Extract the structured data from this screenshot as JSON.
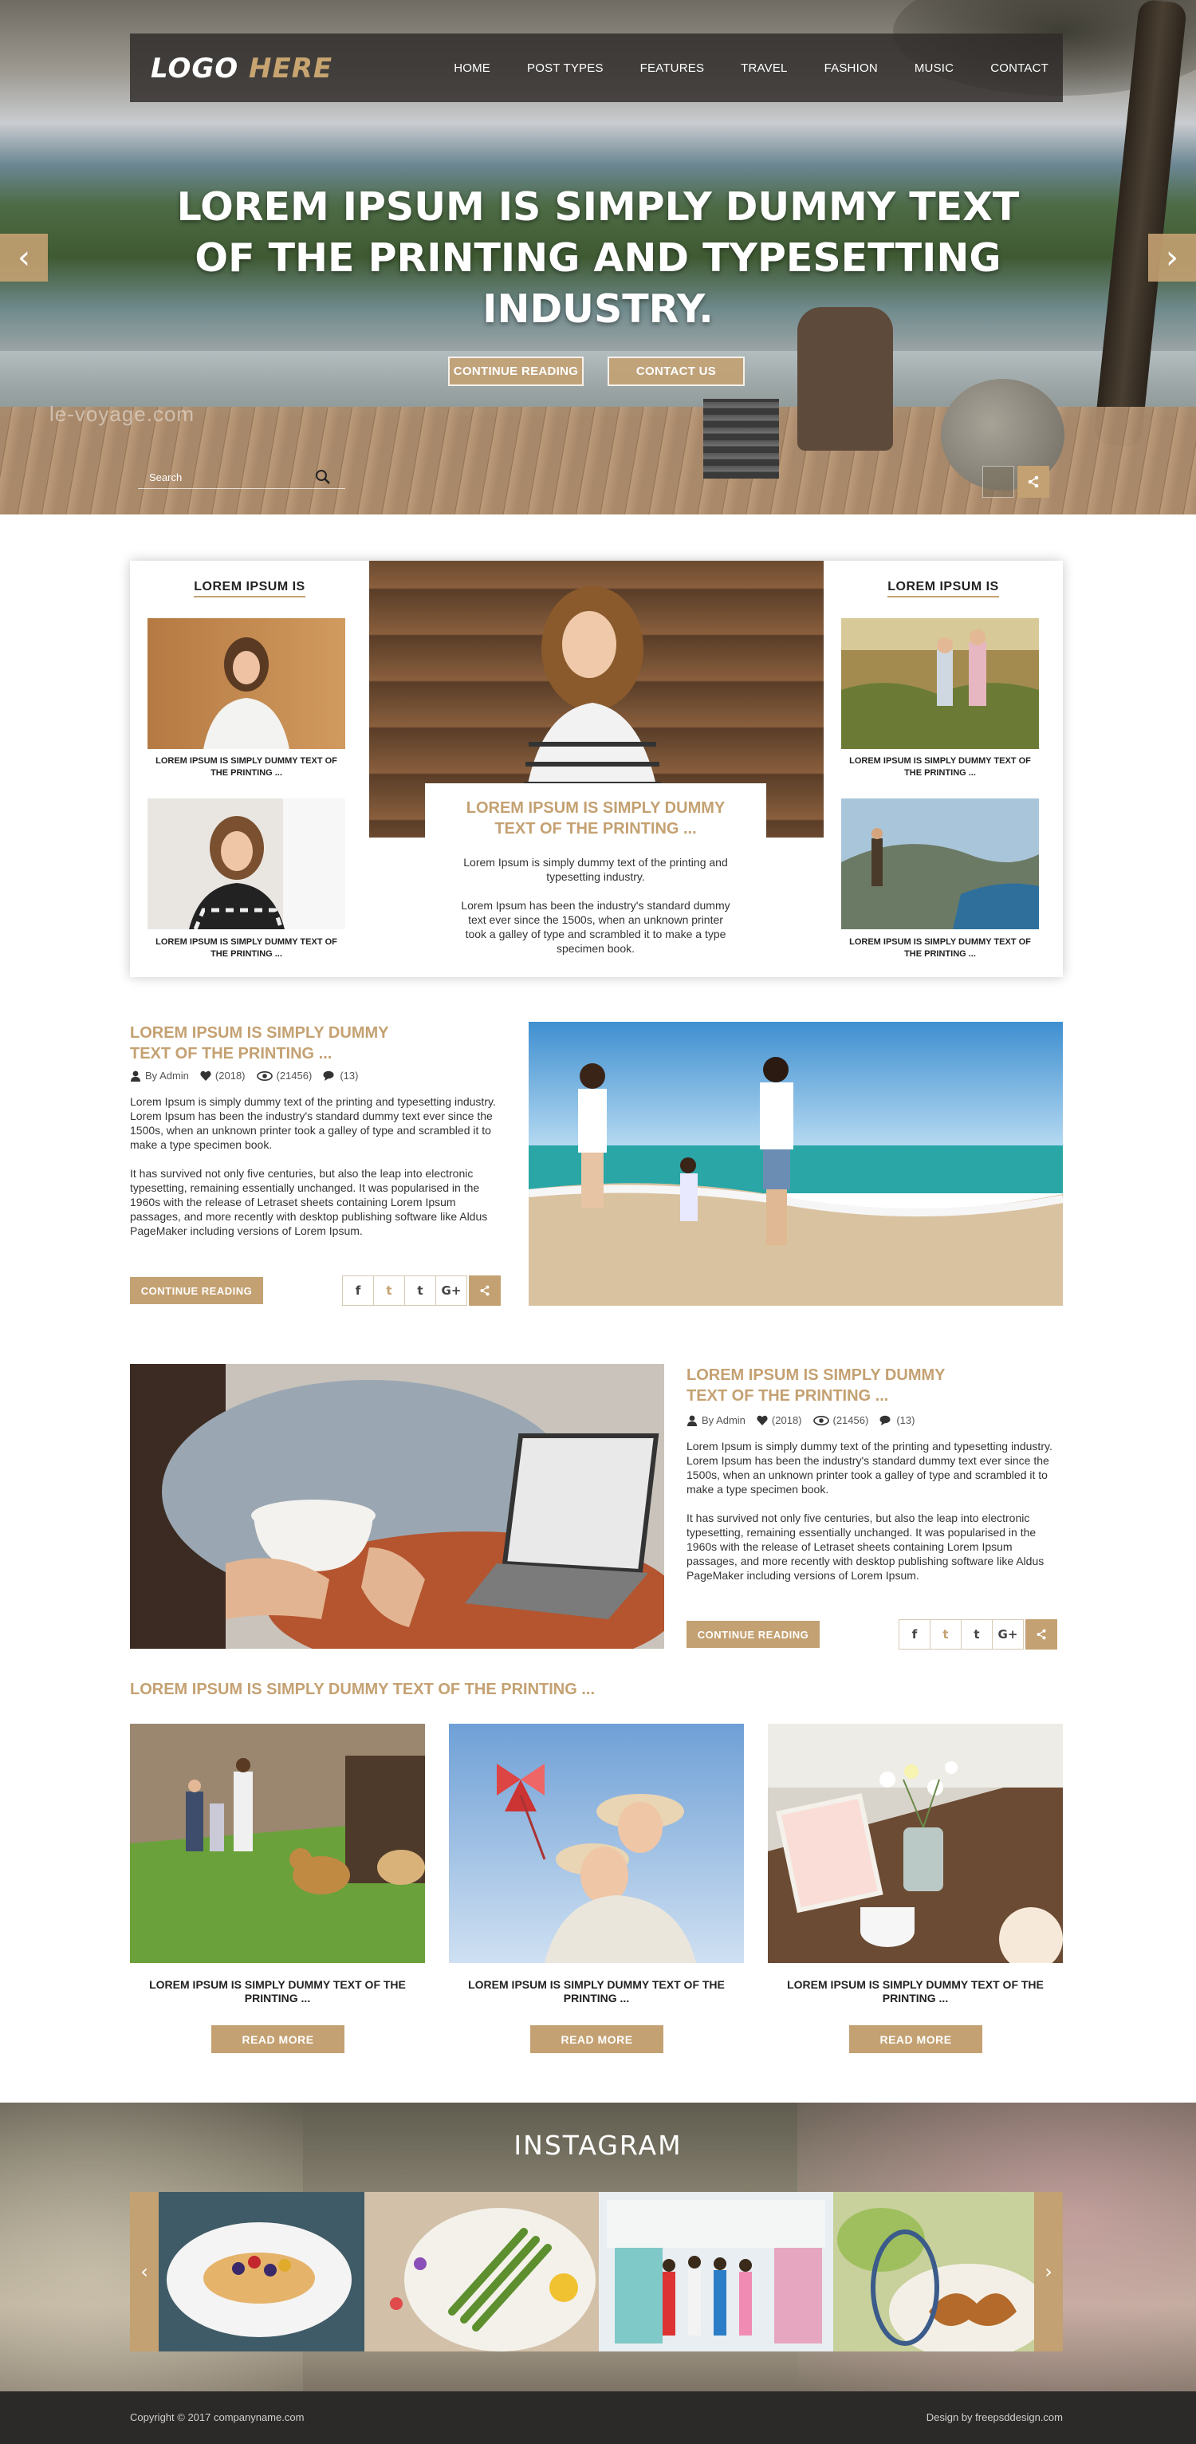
{
  "colors": {
    "accent": "#c4a172",
    "dark": "#2c2a28",
    "text": "#333333"
  },
  "logo": {
    "word1": "LOGO",
    "word2": "HERE"
  },
  "nav": [
    "HOME",
    "POST TYPES",
    "FEATURES",
    "TRAVEL",
    "FASHION",
    "MUSIC",
    "CONTACT"
  ],
  "hero": {
    "title": "LOREM IPSUM IS SIMPLY DUMMY TEXT OF THE PRINTING AND TYPESETTING INDUSTRY.",
    "btn_continue": "CONTINUE READING",
    "btn_contact": "CONTACT US",
    "watermark": "le-voyage.com",
    "search_placeholder": "Search",
    "prev_icon": "chevron-left-icon",
    "next_icon": "chevron-right-icon"
  },
  "featured": {
    "left_heading": "LOREM IPSUM IS",
    "right_heading": "LOREM IPSUM IS",
    "captions": [
      "LOREM IPSUM IS SIMPLY DUMMY TEXT OF THE PRINTING ...",
      "LOREM IPSUM IS SIMPLY DUMMY TEXT OF THE PRINTING ...",
      "LOREM IPSUM IS SIMPLY DUMMY TEXT OF THE PRINTING ...",
      "LOREM IPSUM IS SIMPLY DUMMY TEXT OF THE PRINTING ..."
    ],
    "main_title": "LOREM IPSUM IS SIMPLY DUMMY TEXT OF THE PRINTING ...",
    "main_p1": "Lorem Ipsum is simply dummy text of the printing and typesetting industry.",
    "main_p2": "Lorem Ipsum has been the industry's standard dummy text ever since the 1500s, when an unknown printer took a galley of type and scrambled it to make a type specimen book."
  },
  "articles": [
    {
      "title": "LOREM IPSUM IS SIMPLY DUMMY TEXT OF THE PRINTING ...",
      "author": "By Admin",
      "likes": "(2018)",
      "views": "(21456)",
      "comments": "(13)",
      "p1": "Lorem Ipsum is simply dummy text of the printing and typesetting industry. Lorem Ipsum has been the industry's standard dummy text ever since the 1500s, when an unknown printer took a galley of type and scrambled it to make a type specimen book.",
      "p2": "It has survived not only five centuries, but also the leap into electronic typesetting, remaining essentially unchanged. It was popularised in the 1960s with the release of Letraset sheets containing Lorem Ipsum passages, and more recently with desktop publishing software like Aldus PageMaker including versions of Lorem Ipsum.",
      "continue": "CONTINUE READING"
    },
    {
      "title": "LOREM IPSUM IS SIMPLY DUMMY TEXT OF THE PRINTING ...",
      "author": "By Admin",
      "likes": "(2018)",
      "views": "(21456)",
      "comments": "(13)",
      "p1": "Lorem Ipsum is simply dummy text of the printing and typesetting industry. Lorem Ipsum has been the industry's standard dummy text ever since the 1500s, when an unknown printer took a galley of type and scrambled it to make a type specimen book.",
      "p2": "It has survived not only five centuries, but also the leap into electronic typesetting, remaining essentially unchanged. It was popularised in the 1960s with the release of Letraset sheets containing Lorem Ipsum passages, and more recently with desktop publishing software like Aldus PageMaker including versions of Lorem Ipsum.",
      "continue": "CONTINUE READING"
    }
  ],
  "social": {
    "facebook": "f",
    "twitter": "t",
    "tumblr": "t",
    "gplus": "G+"
  },
  "grid": {
    "title": "LOREM IPSUM IS SIMPLY DUMMY TEXT OF THE PRINTING ...",
    "cards": [
      {
        "caption": "LOREM IPSUM IS SIMPLY DUMMY TEXT OF THE PRINTING ...",
        "button": "READ MORE"
      },
      {
        "caption": "LOREM IPSUM IS SIMPLY DUMMY TEXT OF THE PRINTING ...",
        "button": "READ MORE"
      },
      {
        "caption": "LOREM IPSUM IS SIMPLY DUMMY TEXT OF THE PRINTING ...",
        "button": "READ MORE"
      }
    ]
  },
  "instagram": {
    "title": "INSTAGRAM",
    "prev": "‹",
    "next": "›"
  },
  "footer": {
    "copyright": "Copyright © 2017 companyname.com",
    "design": "Design by freepsddesign.com"
  }
}
